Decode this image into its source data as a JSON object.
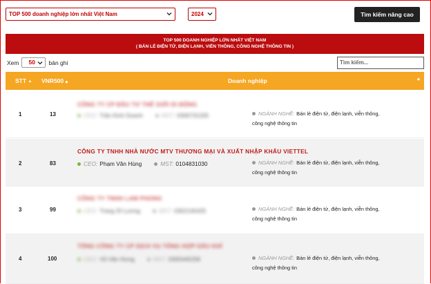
{
  "filters": {
    "list_select": "TOP 500 doanh nghiệp lớn nhất Việt Nam",
    "year_select": "2024",
    "advanced_search": "Tìm kiếm nâng cao"
  },
  "banner": {
    "line1": "TOP 500 DOANH NGHIỆP LỚN NHẤT VIỆT NAM",
    "line2": "( BÁN LẺ ĐIỆN TỬ, ĐIỆN LẠNH, VIỄN THÔNG, CÔNG NGHỆ THÔNG TIN )"
  },
  "controls": {
    "show_label": "Xem",
    "page_length": "50",
    "records_label": "bản ghi",
    "search_placeholder": "Tìm kiếm..."
  },
  "table": {
    "headers": {
      "stt": "STT",
      "vnr": "VNR500",
      "company": "Doanh nghiệp"
    },
    "labels": {
      "ceo": "CEO:",
      "mst": "MST:",
      "industry": "NGÀNH NGHỀ:"
    },
    "rows": [
      {
        "stt": "1",
        "vnr": "13",
        "name": "CÔNG TY CP ĐẦU TƯ THẾ GIỚI DI ĐỘNG",
        "ceo": "Trần Kinh Doanh",
        "mst": "0306731335",
        "industry": "Bán lẻ điện tử, điện lạnh, viễn thông, công nghệ thông tin",
        "blurred": true
      },
      {
        "stt": "2",
        "vnr": "83",
        "name": "CÔNG TY TNHH NHÀ NƯỚC MTV THƯƠNG MẠI VÀ XUẤT NHẬP KHẨU VIETTEL",
        "ceo": "Phạm Văn Hùng",
        "mst": "0104831030",
        "industry": "Bán lẻ điện tử, điện lạnh, viễn thông, công nghệ thông tin",
        "blurred": false
      },
      {
        "stt": "3",
        "vnr": "99",
        "name": "CÔNG TY TNHH LAM PHONG",
        "ceo": "Trang Sĩ Lương",
        "mst": "0302145425",
        "industry": "Bán lẻ điện tử, điện lạnh, viễn thông, công nghệ thông tin",
        "blurred": true
      },
      {
        "stt": "4",
        "vnr": "100",
        "name": "TỔNG CÔNG TY CP DỊCH VỤ TỔNG HỢP DẦU KHÍ",
        "ceo": "Võ Văn Hưng",
        "mst": "0305445258",
        "industry": "Bán lẻ điện tử, điện lạnh, viễn thông, công nghệ thông tin",
        "blurred": true
      }
    ]
  },
  "colors": {
    "brand_red": "#bb0d0f",
    "header_orange": "#f5a623",
    "dark_button": "#222222"
  }
}
